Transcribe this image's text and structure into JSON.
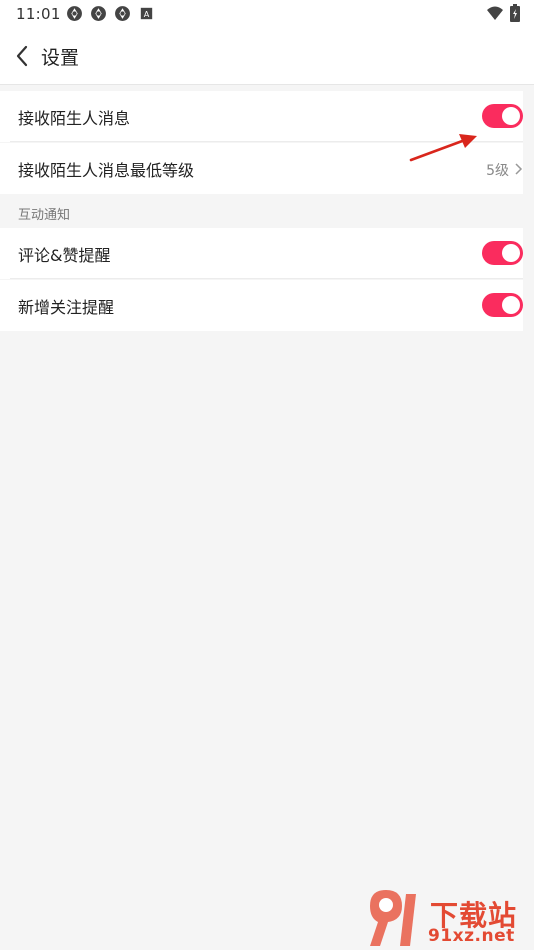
{
  "status_bar": {
    "time": "11:01",
    "left_icons": [
      "aperture-icon",
      "aperture-icon",
      "aperture-icon",
      "a-badge-icon"
    ],
    "right_icons": [
      "wifi-icon",
      "battery-icon"
    ]
  },
  "header": {
    "title": "设置"
  },
  "rows": {
    "accept_stranger": {
      "label": "接收陌生人消息",
      "toggle_on": true
    },
    "stranger_min_level": {
      "label": "接收陌生人消息最低等级",
      "value": "5级"
    },
    "section_label": "互动通知",
    "comment_like": {
      "label": "评论&赞提醒",
      "toggle_on": true
    },
    "new_follow": {
      "label": "新增关注提醒",
      "toggle_on": true
    }
  },
  "watermark": {
    "top": "下载站",
    "bottom": "91xz.net"
  },
  "colors": {
    "accent": "#fa2c5e",
    "background": "#f5f5f5",
    "annotation": "#d9261c"
  }
}
